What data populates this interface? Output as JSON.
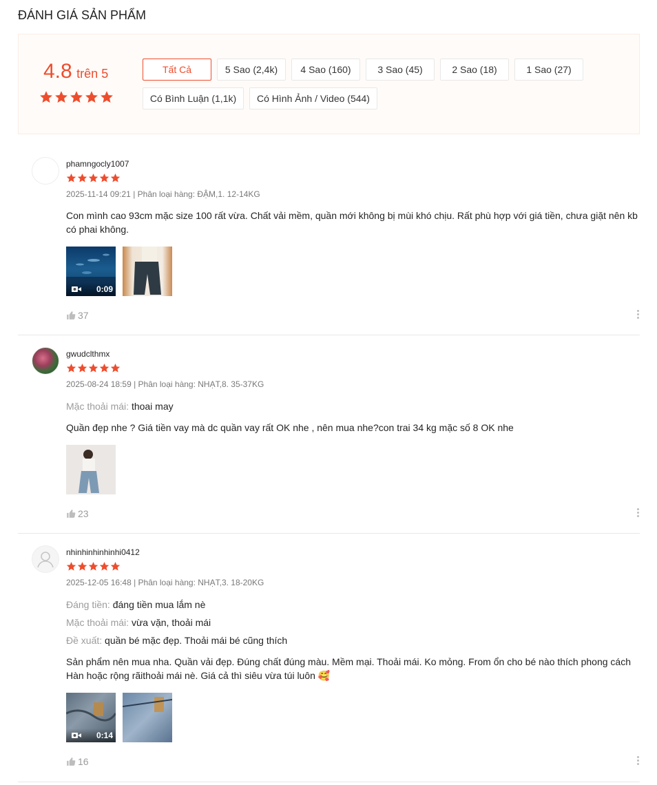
{
  "page_title": "ĐÁNH GIÁ SẢN PHẨM",
  "overview": {
    "rating": "4.8",
    "rating_suffix": "trên 5",
    "star_count": 5
  },
  "filters": [
    {
      "label": "Tất Cả",
      "active": true
    },
    {
      "label": "5 Sao (2,4k)"
    },
    {
      "label": "4 Sao (160)"
    },
    {
      "label": "3 Sao (45)"
    },
    {
      "label": "2 Sao (18)"
    },
    {
      "label": "1 Sao (27)"
    },
    {
      "label": "Có Bình Luận (1,1k)"
    },
    {
      "label": "Có Hình Ảnh / Video (544)"
    }
  ],
  "reviews": [
    {
      "username": "phamngocly1007",
      "stars": 5,
      "meta": "2025-11-14 09:21 | Phân loại hàng: ĐẬM,1. 12-14KG",
      "content": "Con mình cao 93cm mặc size 100 rất vừa. Chất vải mềm, quần mới không bị mùi khó chịu. Rất phù hợp với giá tiền, chưa giặt nên kb có phai không.",
      "video_duration": "0:09",
      "likes": "37"
    },
    {
      "username": "gwudclthmx",
      "stars": 5,
      "meta": "2025-08-24 18:59 | Phân loại hàng: NHẠT,8. 35-37KG",
      "attributes": [
        {
          "key": "Mặc thoải mái:",
          "value": "thoai may"
        }
      ],
      "content": "Quần đẹp nhe ? Giá tiền vay mà dc quần vay rất OK nhe , nên mua nhe?con trai 34 kg mặc số 8 OK nhe",
      "likes": "23"
    },
    {
      "username": "nhinhinhinhinhi0412",
      "stars": 5,
      "meta": "2025-12-05 16:48 | Phân loại hàng: NHẠT,3. 18-20KG",
      "attributes": [
        {
          "key": "Đáng tiền:",
          "value": "đáng tiền mua lắm nè"
        },
        {
          "key": "Mặc thoải mái:",
          "value": "vừa vặn, thoải mái"
        },
        {
          "key": "Đề xuất:",
          "value": "quần bé mặc đẹp. Thoải mái bé cũng thích"
        }
      ],
      "content": "Sản phẩm nên mua nha. Quần vải đẹp. Đúng chất đúng màu. Mềm mại. Thoải mái. Ko mỏng. From ổn cho bé nào thích phong cách Hàn hoặc rộng rãithoải mái nè. Giá cả thì siêu vừa túi luôn 🥰",
      "video_duration": "0:14",
      "likes": "16"
    }
  ],
  "colors": {
    "accent": "#ee4d2d",
    "overview_bg": "#fffbf8",
    "muted_text": "#757575"
  },
  "icons": [
    "star-icon",
    "video-camera-icon",
    "thumbs-up-icon",
    "more-vertical-icon",
    "default-avatar-icon"
  ]
}
